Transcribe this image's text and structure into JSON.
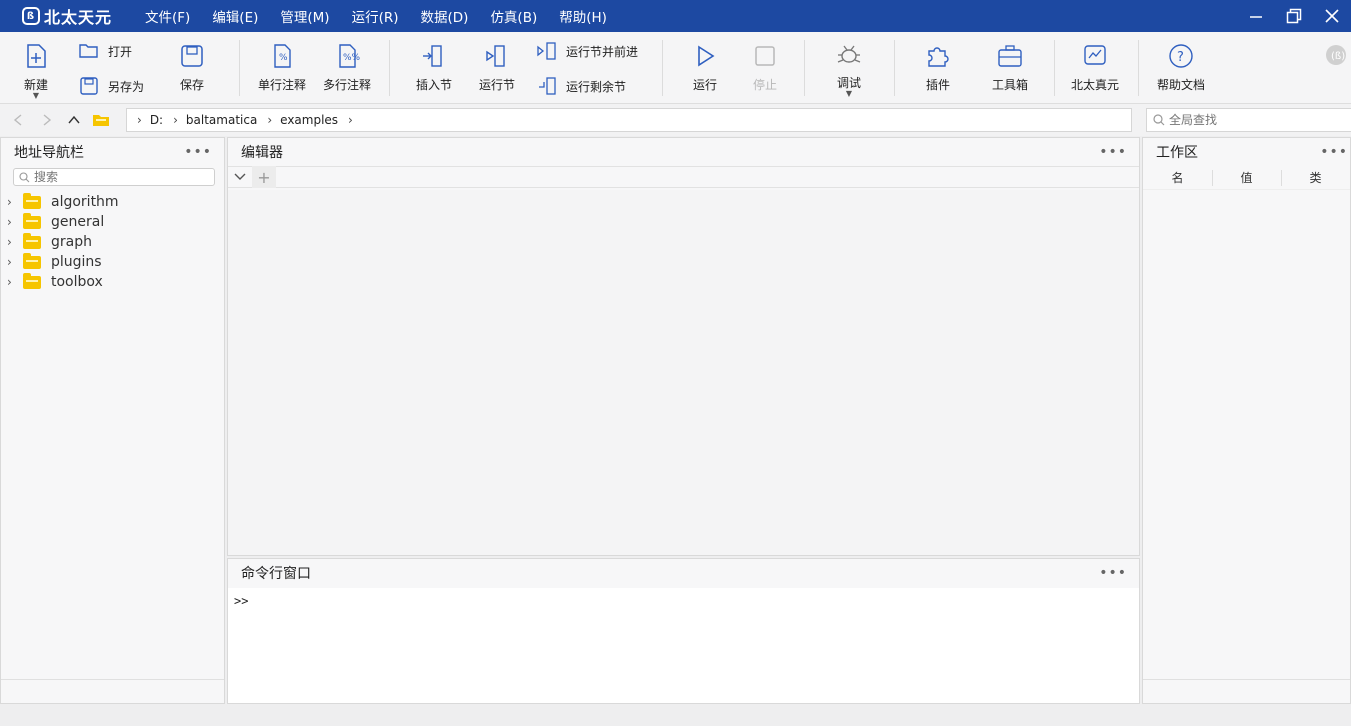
{
  "app": {
    "brand": "北太天元"
  },
  "menu": [
    {
      "label": "文件(F)"
    },
    {
      "label": "编辑(E)"
    },
    {
      "label": "管理(M)"
    },
    {
      "label": "运行(R)"
    },
    {
      "label": "数据(D)"
    },
    {
      "label": "仿真(B)"
    },
    {
      "label": "帮助(H)"
    }
  ],
  "toolbar": {
    "new": "新建",
    "open": "打开",
    "save_as": "另存为",
    "save": "保存",
    "single_comment": "单行注释",
    "multi_comment": "多行注释",
    "insert_section": "插入节",
    "run_section": "运行节",
    "run_section_advance": "运行节并前进",
    "run_remaining": "运行剩余节",
    "run": "运行",
    "stop": "停止",
    "debug": "调试",
    "plugins": "插件",
    "toolbox": "工具箱",
    "beitai": "北太真元",
    "help_docs": "帮助文档"
  },
  "address": {
    "crumbs": [
      "D:",
      "baltamatica",
      "examples"
    ],
    "global_search_placeholder": "全局查找"
  },
  "navigator": {
    "title": "地址导航栏",
    "search_placeholder": "搜索",
    "items": [
      "algorithm",
      "general",
      "graph",
      "plugins",
      "toolbox"
    ]
  },
  "editor": {
    "title": "编辑器"
  },
  "command": {
    "title": "命令行窗口",
    "prompt": ">>"
  },
  "workspace": {
    "title": "工作区",
    "columns": [
      "名",
      "值",
      "类"
    ]
  },
  "colors": {
    "titlebar": "#1d49a2",
    "icon": "#2f5fc0",
    "folder": "#f6c500"
  }
}
